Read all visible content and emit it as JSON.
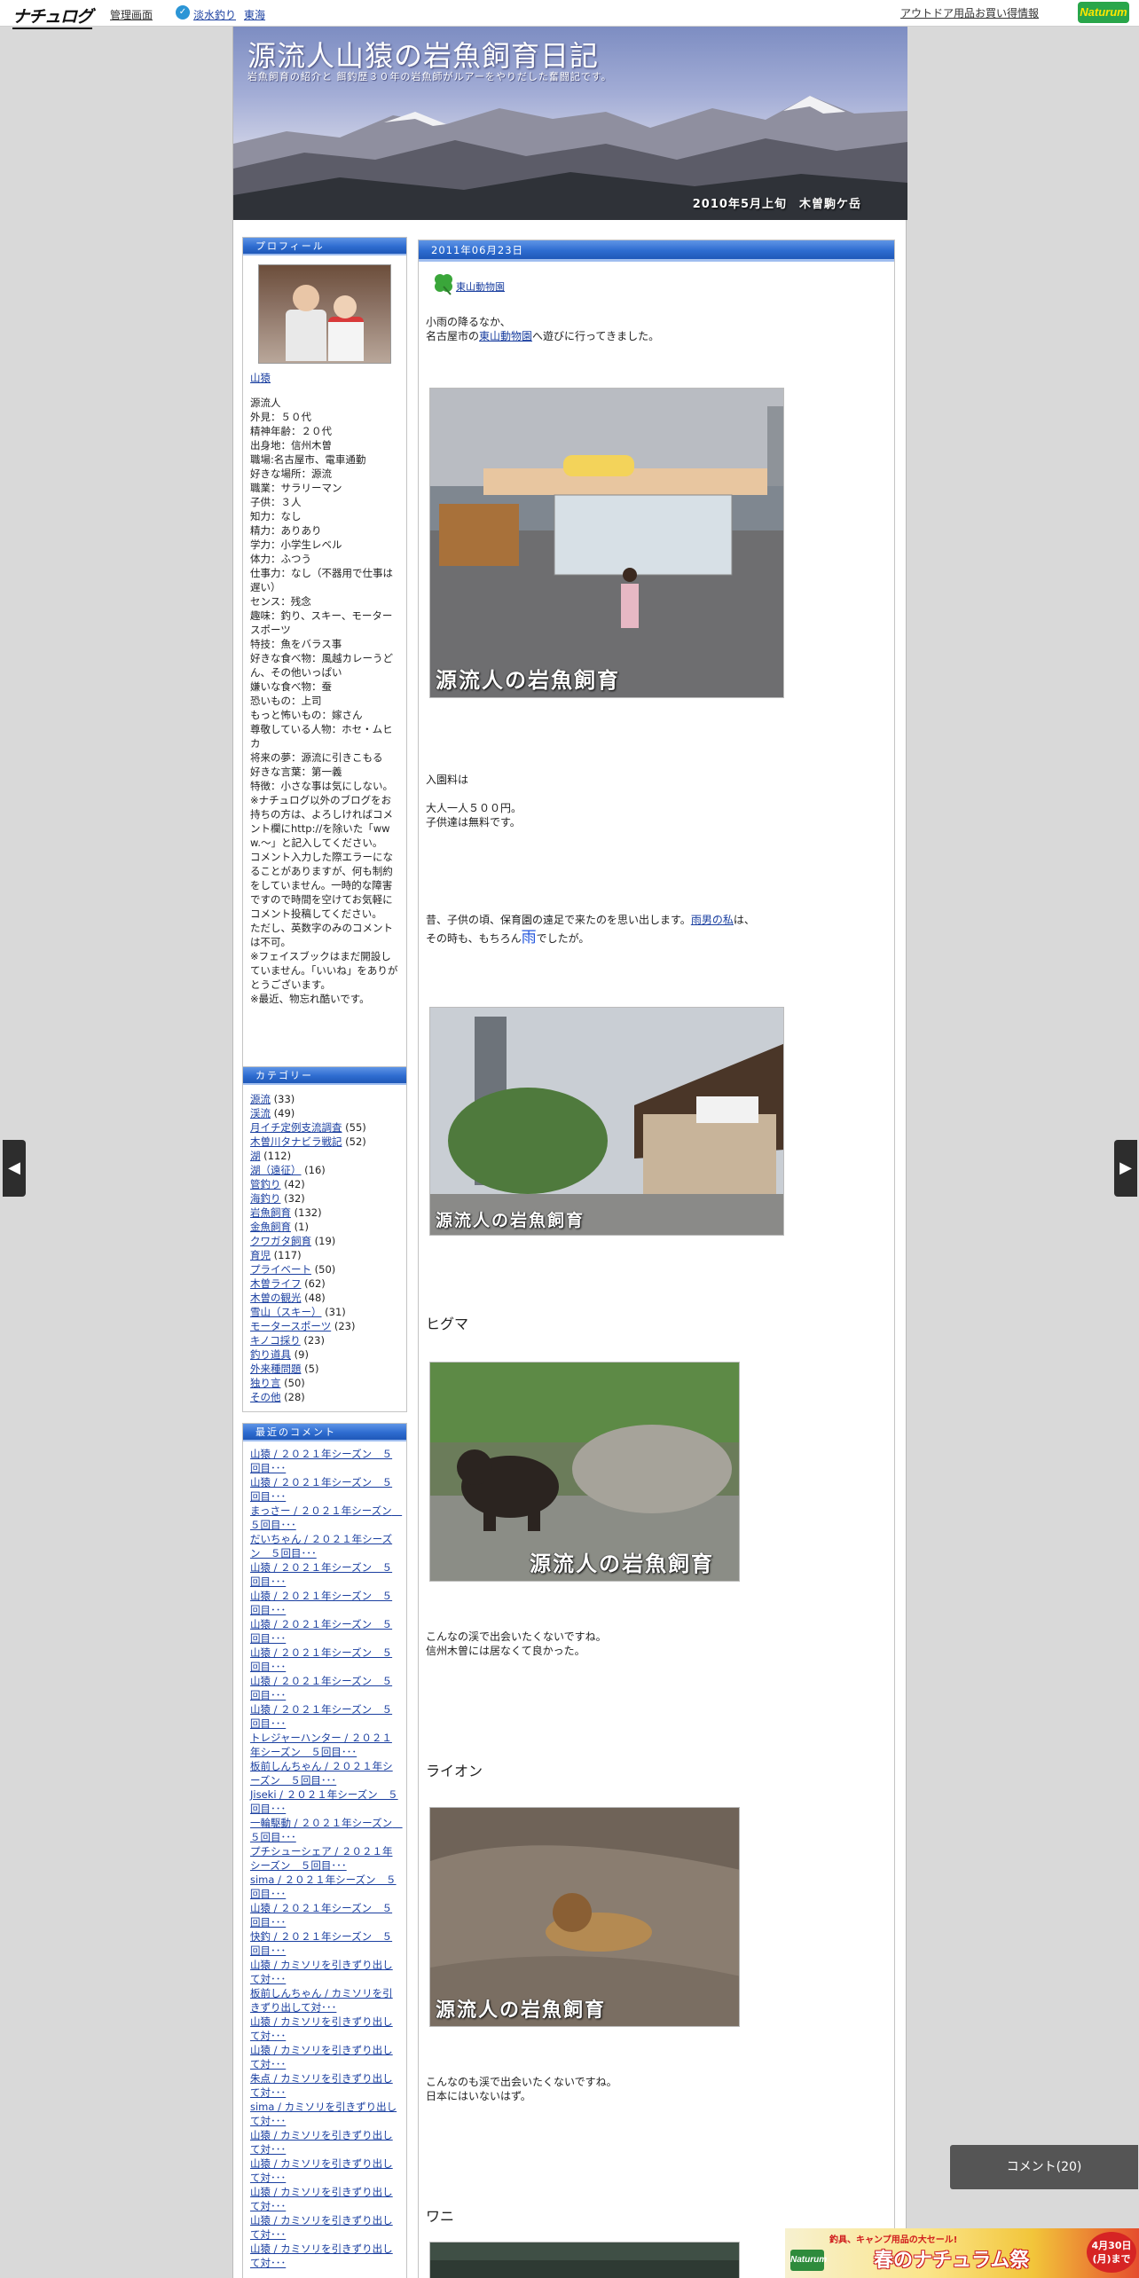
{
  "topbar": {
    "logo": "ナチュログ",
    "admin": "管理画面",
    "badge_icon": "✓",
    "category1": "淡水釣り",
    "category2": "東海",
    "ranking": "アウトドア用品お買い得情報",
    "brand": "Naturum"
  },
  "header": {
    "title": "源流人山猿の岩魚飼育日記",
    "subtitle": "岩魚飼育の紹介と 餌釣歴３０年の岩魚師がルアーをやりだした奮闘記です。",
    "caption": "2010年5月上旬　木曽駒ケ岳"
  },
  "sidebar": {
    "profile": {
      "heading": "プロフィール",
      "name": "山猿",
      "lines": [
        "源流人",
        "外見：５０代",
        "精神年齢：２０代",
        "出身地：信州木曽",
        "職場:名古屋市、電車通勤",
        "好きな場所：源流",
        "職業：サラリーマン",
        "子供：３人",
        "知力：なし",
        "精力：ありあり",
        "学力：小学生レベル",
        "体力：ふつう",
        "仕事力：なし（不器用で仕事は遅い）",
        "センス：残念",
        "趣味：釣り、スキー、モータースポーツ",
        "特技：魚をバラス事",
        "好きな食べ物：風越カレーうどん、その他いっぱい",
        "嫌いな食べ物：蚕",
        "恐いもの：上司",
        "もっと怖いもの：嫁さん",
        "尊敬している人物：ホセ・ムヒカ",
        "将来の夢：源流に引きこもる",
        "好きな言葉：第一義",
        "特徴：小さな事は気にしない。",
        "※ナチュログ以外のブログをお持ちの方は、よろしければコメント欄にhttp://を除いた「www.～」と記入してください。",
        "コメント入力した際エラーになることがありますが、何も制約をしていません。一時的な障害ですので時間を空けてお気軽にコメント投稿してください。",
        "ただし、英数字のみのコメントは不可。",
        "※フェイスブックはまだ開設していません。「いいね」をありがとうございます。",
        "※最近、物忘れ酷いです。"
      ]
    },
    "categories": {
      "heading": "カテゴリー",
      "items": [
        {
          "name": "源流",
          "count": "(33)"
        },
        {
          "name": "渓流",
          "count": "(49)"
        },
        {
          "name": "月イチ定例支流調査",
          "count": "(55)"
        },
        {
          "name": "木曽川タナビラ戦記",
          "count": "(52)"
        },
        {
          "name": "湖",
          "count": "(112)"
        },
        {
          "name": "湖（遠征）",
          "count": "(16)"
        },
        {
          "name": "管釣り",
          "count": "(42)"
        },
        {
          "name": "海釣り",
          "count": "(32)"
        },
        {
          "name": "岩魚飼育",
          "count": "(132)"
        },
        {
          "name": "金魚飼育",
          "count": "(1)"
        },
        {
          "name": "クワガタ飼育",
          "count": "(19)"
        },
        {
          "name": "育児",
          "count": "(117)"
        },
        {
          "name": "プライベート",
          "count": "(50)"
        },
        {
          "name": "木曽ライフ",
          "count": "(62)"
        },
        {
          "name": "木曽の観光",
          "count": "(48)"
        },
        {
          "name": "雪山（スキー）",
          "count": "(31)"
        },
        {
          "name": "モータースポーツ",
          "count": "(23)"
        },
        {
          "name": "キノコ採り",
          "count": "(23)"
        },
        {
          "name": "釣り道具",
          "count": "(9)"
        },
        {
          "name": "外来種問題",
          "count": "(5)"
        },
        {
          "name": "独り言",
          "count": "(50)"
        },
        {
          "name": "その他",
          "count": "(28)"
        }
      ]
    },
    "recent": {
      "heading": "最近のコメント",
      "items": [
        "山猿 / ２０２１年シーズン　５回目･･･",
        "山猿 / ２０２１年シーズン　５回目･･･",
        "まっさー / ２０２１年シーズン　５回目･･･",
        "だいちゃん / ２０２１年シーズン　５回目･･･",
        "山猿 / ２０２１年シーズン　５回目･･･",
        "山猿 / ２０２１年シーズン　５回目･･･",
        "山猿 / ２０２１年シーズン　５回目･･･",
        "山猿 / ２０２１年シーズン　５回目･･･",
        "山猿 / ２０２１年シーズン　５回目･･･",
        "山猿 / ２０２１年シーズン　５回目･･･",
        "トレジャーハンター / ２０２１年シーズン　５回目･･･",
        "板前しんちゃん / ２０２１年シーズン　５回目･･･",
        "Jiseki / ２０２１年シーズン　５回目･･･",
        "一輪駆動 / ２０２１年シーズン　５回目･･･",
        "プチシューシェア / ２０２１年シーズン　５回目･･･",
        "sima / ２０２１年シーズン　５回目･･･",
        "山猿 / ２０２１年シーズン　５回目･･･",
        "快釣 / ２０２１年シーズン　５回目･･･",
        "山猿 / カミソリを引きずり出して対･･･",
        "板前しんちゃん / カミソリを引きずり出して対･･･",
        "山猿 / カミソリを引きずり出して対･･･",
        "山猿 / カミソリを引きずり出して対･･･",
        "朱点 / カミソリを引きずり出して対･･･",
        "sima / カミソリを引きずり出して対･･･",
        "山猿 / カミソリを引きずり出して対･･･",
        "山猿 / カミソリを引きずり出して対･･･",
        "山猿 / カミソリを引きずり出して対･･･",
        "山猿 / カミソリを引きずり出して対･･･",
        "山猿 / カミソリを引きずり出して対･･･"
      ]
    }
  },
  "post": {
    "date": "2011年06月23日",
    "category_icon": "clover-icon",
    "category": "東山動物園",
    "intro_line1": "小雨の降るなか、",
    "intro_pre": "名古屋市の",
    "intro_link": "東山動物園",
    "intro_post": "へ遊びに行ってきました。",
    "watermark": "源流人の岩魚飼育",
    "fee_label": "入園料は",
    "fee_line1": "大人一人５００円。",
    "fee_line2": "子供達は無料です。",
    "memory_pre": "昔、子供の頃、保育園の遠足で来たのを思い出します。",
    "memory_link": "雨男の私",
    "memory_post": "は、",
    "memory2_pre": "その時も、もちろん",
    "memory2_rain": "雨",
    "memory2_post": "でしたが。",
    "bear_heading": "ヒグマ",
    "bear_line1": "こんなの渓で出会いたくないですね。",
    "bear_line2": "信州木曽には居なくて良かった。",
    "lion_heading": "ライオン",
    "lion_line1": "こんなのも渓で出会いたくないですね。",
    "lion_line2": "日本にはいないはず。",
    "croc_heading": "ワニ"
  },
  "overlay": {
    "prev_icon": "◀",
    "next_icon": "▶",
    "comment_button": "コメント(20)",
    "banner_line1": "釣具、キャンプ用品の大セール!",
    "banner_line2": "春のナチュラム祭",
    "banner_brand": "Naturum",
    "banner_deadline": "4月30日(月)まで"
  }
}
